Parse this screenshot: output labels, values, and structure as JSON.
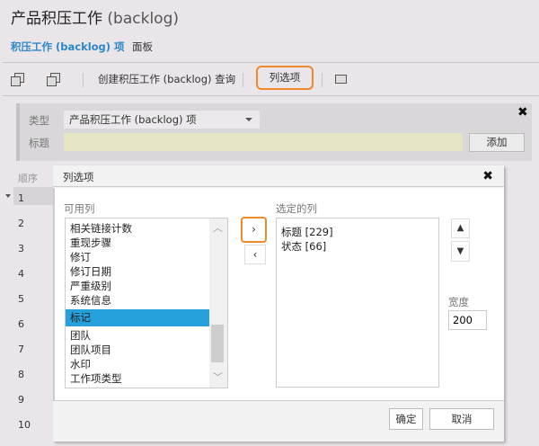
{
  "header": {
    "title": "产品积压工作",
    "title_suffix": "(backlog)"
  },
  "tabs": [
    {
      "label": "积压工作 (backlog) 项",
      "active": true
    },
    {
      "label": "面板",
      "active": false
    }
  ],
  "toolbar": {
    "create_query": "创建积压工作 (backlog) 查询",
    "column_options": "列选项",
    "icons": [
      "expand-all-icon",
      "collapse-all-icon",
      "email-icon"
    ]
  },
  "add_panel": {
    "type_label": "类型",
    "type_value": "产品积压工作 (backlog) 项",
    "title_label": "标题",
    "title_value": "",
    "add_button": "添加"
  },
  "grid": {
    "order_header": "顺序",
    "rows": [
      "1",
      "2",
      "3",
      "4",
      "5",
      "6",
      "7",
      "8",
      "9",
      "10"
    ]
  },
  "dialog": {
    "title": "列选项",
    "available_label": "可用列",
    "available": [
      "相关链接计数",
      "重现步骤",
      "修订",
      "修订日期",
      "严重级别",
      "系统信息",
      "标记",
      "团队",
      "团队项目",
      "水印",
      "工作项类型"
    ],
    "available_selected": "标记",
    "selected_label": "选定的列",
    "selected": [
      "标题 [229]",
      "状态 [66]"
    ],
    "width_label": "宽度",
    "width_value": "200",
    "ok": "确定",
    "cancel": "取消"
  },
  "colors": {
    "accent": "#2b88c8",
    "highlight": "#f0892a",
    "selection": "#26a0da"
  }
}
